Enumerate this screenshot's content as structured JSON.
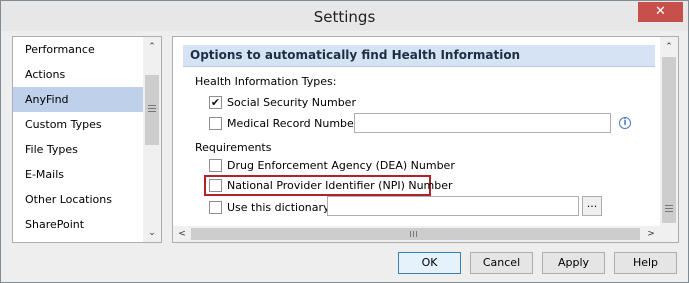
{
  "window": {
    "title": "Settings",
    "close_glyph": "✕"
  },
  "sidebar": {
    "items": [
      {
        "label": "Performance"
      },
      {
        "label": "Actions"
      },
      {
        "label": "AnyFind"
      },
      {
        "label": "Custom Types"
      },
      {
        "label": "File Types"
      },
      {
        "label": "E-Mails"
      },
      {
        "label": "Other Locations"
      },
      {
        "label": "SharePoint"
      }
    ],
    "selected": "AnyFind",
    "scroll_up": "⌃",
    "scroll_down": "⌄"
  },
  "panel": {
    "section_title": "Options to automatically find Health Information",
    "health_types_label": "Health Information Types:",
    "ssn": {
      "label": "Social Security Number",
      "checked": true
    },
    "mrn": {
      "label": "Medical Record Number:",
      "checked": false,
      "value": ""
    },
    "requirements_label": "Requirements",
    "dea": {
      "label": "Drug Enforcement Agency (DEA) Number",
      "checked": false
    },
    "npi": {
      "label": "National Provider Identifier (NPI) Number",
      "checked": false
    },
    "dictionary": {
      "label": "Use this dictionary:",
      "checked": false,
      "value": ""
    },
    "browse_label": "...",
    "info_glyph": "i",
    "check_glyph": "✔",
    "scroll_left": "<",
    "scroll_right": ">",
    "scroll_up": "⌃",
    "scroll_down": "⌄"
  },
  "buttons": {
    "ok": "OK",
    "cancel": "Cancel",
    "apply": "Apply",
    "help": "Help"
  },
  "colors": {
    "selection": "#bfd0ea",
    "section_header": "#d6e3f4",
    "highlight": "#b0232a",
    "close": "#c7504a"
  }
}
